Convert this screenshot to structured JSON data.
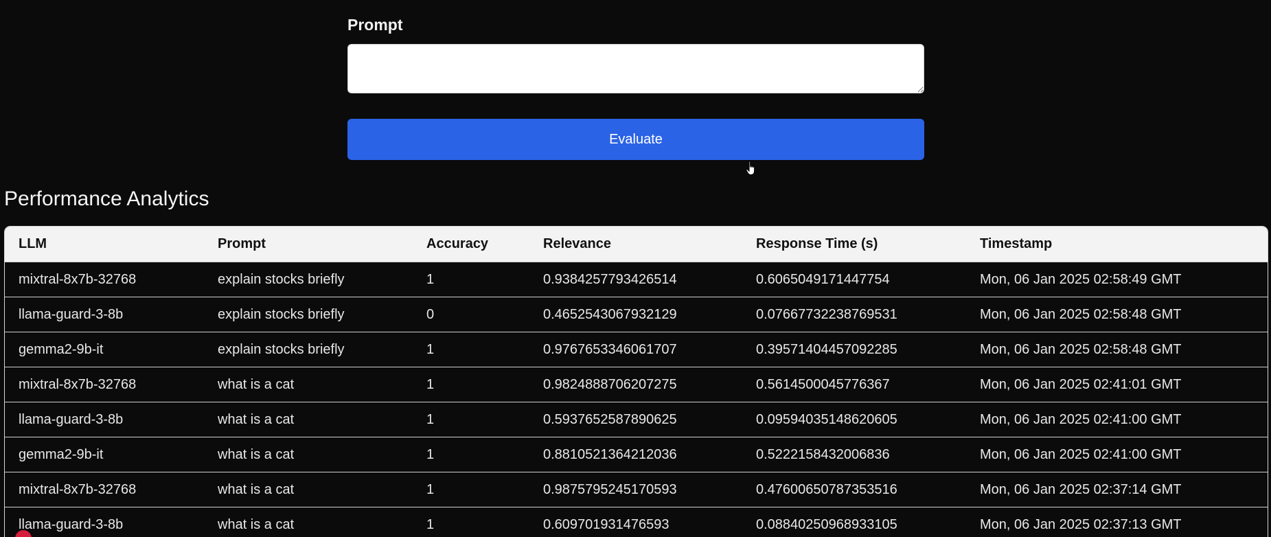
{
  "form": {
    "prompt_label": "Prompt",
    "prompt_value": "",
    "evaluate_label": "Evaluate"
  },
  "analytics": {
    "title": "Performance Analytics",
    "columns": [
      "LLM",
      "Prompt",
      "Accuracy",
      "Relevance",
      "Response Time (s)",
      "Timestamp"
    ],
    "rows": [
      [
        "mixtral-8x7b-32768",
        "explain stocks briefly",
        "1",
        "0.9384257793426514",
        "0.6065049171447754",
        "Mon, 06 Jan 2025 02:58:49 GMT"
      ],
      [
        "llama-guard-3-8b",
        "explain stocks briefly",
        "0",
        "0.4652543067932129",
        "0.07667732238769531",
        "Mon, 06 Jan 2025 02:58:48 GMT"
      ],
      [
        "gemma2-9b-it",
        "explain stocks briefly",
        "1",
        "0.9767653346061707",
        "0.39571404457092285",
        "Mon, 06 Jan 2025 02:58:48 GMT"
      ],
      [
        "mixtral-8x7b-32768",
        "what is a cat",
        "1",
        "0.9824888706207275",
        "0.5614500045776367",
        "Mon, 06 Jan 2025 02:41:01 GMT"
      ],
      [
        "llama-guard-3-8b",
        "what is a cat",
        "1",
        "0.5937652587890625",
        "0.09594035148620605",
        "Mon, 06 Jan 2025 02:41:00 GMT"
      ],
      [
        "gemma2-9b-it",
        "what is a cat",
        "1",
        "0.8810521364212036",
        "0.5222158432006836",
        "Mon, 06 Jan 2025 02:41:00 GMT"
      ],
      [
        "mixtral-8x7b-32768",
        "what is a cat",
        "1",
        "0.9875795245170593",
        "0.47600650787353516",
        "Mon, 06 Jan 2025 02:37:14 GMT"
      ],
      [
        "llama-guard-3-8b",
        "what is a cat",
        "1",
        "0.609701931476593",
        "0.08840250968933105",
        "Mon, 06 Jan 2025 02:37:13 GMT"
      ]
    ]
  },
  "icons": {
    "cursor": "hand-pointer-icon",
    "status_dot": "record-indicator-icon"
  },
  "colors": {
    "background": "#0b0b0c",
    "button": "#2b63e6",
    "header_row": "#f3f3f4",
    "indicator": "#d71e3c"
  }
}
